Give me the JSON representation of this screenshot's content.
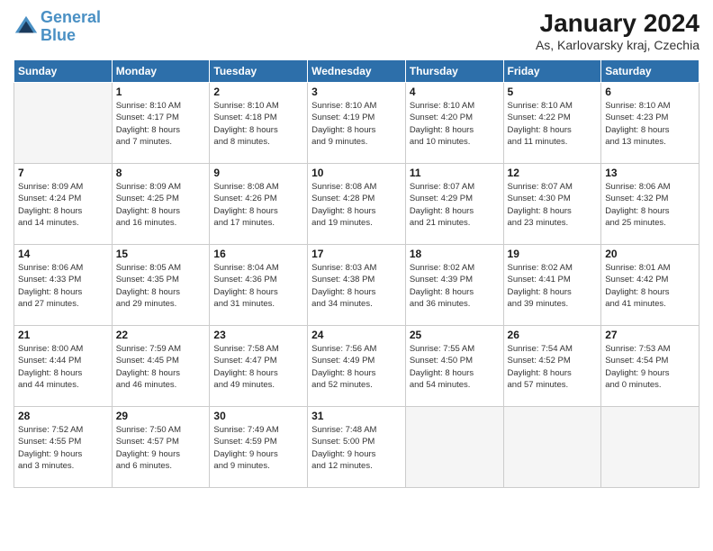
{
  "header": {
    "logo_line1": "General",
    "logo_line2": "Blue",
    "month_year": "January 2024",
    "location": "As, Karlovarsky kraj, Czechia"
  },
  "weekdays": [
    "Sunday",
    "Monday",
    "Tuesday",
    "Wednesday",
    "Thursday",
    "Friday",
    "Saturday"
  ],
  "weeks": [
    [
      {
        "num": "",
        "info": ""
      },
      {
        "num": "1",
        "info": "Sunrise: 8:10 AM\nSunset: 4:17 PM\nDaylight: 8 hours\nand 7 minutes."
      },
      {
        "num": "2",
        "info": "Sunrise: 8:10 AM\nSunset: 4:18 PM\nDaylight: 8 hours\nand 8 minutes."
      },
      {
        "num": "3",
        "info": "Sunrise: 8:10 AM\nSunset: 4:19 PM\nDaylight: 8 hours\nand 9 minutes."
      },
      {
        "num": "4",
        "info": "Sunrise: 8:10 AM\nSunset: 4:20 PM\nDaylight: 8 hours\nand 10 minutes."
      },
      {
        "num": "5",
        "info": "Sunrise: 8:10 AM\nSunset: 4:22 PM\nDaylight: 8 hours\nand 11 minutes."
      },
      {
        "num": "6",
        "info": "Sunrise: 8:10 AM\nSunset: 4:23 PM\nDaylight: 8 hours\nand 13 minutes."
      }
    ],
    [
      {
        "num": "7",
        "info": "Sunrise: 8:09 AM\nSunset: 4:24 PM\nDaylight: 8 hours\nand 14 minutes."
      },
      {
        "num": "8",
        "info": "Sunrise: 8:09 AM\nSunset: 4:25 PM\nDaylight: 8 hours\nand 16 minutes."
      },
      {
        "num": "9",
        "info": "Sunrise: 8:08 AM\nSunset: 4:26 PM\nDaylight: 8 hours\nand 17 minutes."
      },
      {
        "num": "10",
        "info": "Sunrise: 8:08 AM\nSunset: 4:28 PM\nDaylight: 8 hours\nand 19 minutes."
      },
      {
        "num": "11",
        "info": "Sunrise: 8:07 AM\nSunset: 4:29 PM\nDaylight: 8 hours\nand 21 minutes."
      },
      {
        "num": "12",
        "info": "Sunrise: 8:07 AM\nSunset: 4:30 PM\nDaylight: 8 hours\nand 23 minutes."
      },
      {
        "num": "13",
        "info": "Sunrise: 8:06 AM\nSunset: 4:32 PM\nDaylight: 8 hours\nand 25 minutes."
      }
    ],
    [
      {
        "num": "14",
        "info": "Sunrise: 8:06 AM\nSunset: 4:33 PM\nDaylight: 8 hours\nand 27 minutes."
      },
      {
        "num": "15",
        "info": "Sunrise: 8:05 AM\nSunset: 4:35 PM\nDaylight: 8 hours\nand 29 minutes."
      },
      {
        "num": "16",
        "info": "Sunrise: 8:04 AM\nSunset: 4:36 PM\nDaylight: 8 hours\nand 31 minutes."
      },
      {
        "num": "17",
        "info": "Sunrise: 8:03 AM\nSunset: 4:38 PM\nDaylight: 8 hours\nand 34 minutes."
      },
      {
        "num": "18",
        "info": "Sunrise: 8:02 AM\nSunset: 4:39 PM\nDaylight: 8 hours\nand 36 minutes."
      },
      {
        "num": "19",
        "info": "Sunrise: 8:02 AM\nSunset: 4:41 PM\nDaylight: 8 hours\nand 39 minutes."
      },
      {
        "num": "20",
        "info": "Sunrise: 8:01 AM\nSunset: 4:42 PM\nDaylight: 8 hours\nand 41 minutes."
      }
    ],
    [
      {
        "num": "21",
        "info": "Sunrise: 8:00 AM\nSunset: 4:44 PM\nDaylight: 8 hours\nand 44 minutes."
      },
      {
        "num": "22",
        "info": "Sunrise: 7:59 AM\nSunset: 4:45 PM\nDaylight: 8 hours\nand 46 minutes."
      },
      {
        "num": "23",
        "info": "Sunrise: 7:58 AM\nSunset: 4:47 PM\nDaylight: 8 hours\nand 49 minutes."
      },
      {
        "num": "24",
        "info": "Sunrise: 7:56 AM\nSunset: 4:49 PM\nDaylight: 8 hours\nand 52 minutes."
      },
      {
        "num": "25",
        "info": "Sunrise: 7:55 AM\nSunset: 4:50 PM\nDaylight: 8 hours\nand 54 minutes."
      },
      {
        "num": "26",
        "info": "Sunrise: 7:54 AM\nSunset: 4:52 PM\nDaylight: 8 hours\nand 57 minutes."
      },
      {
        "num": "27",
        "info": "Sunrise: 7:53 AM\nSunset: 4:54 PM\nDaylight: 9 hours\nand 0 minutes."
      }
    ],
    [
      {
        "num": "28",
        "info": "Sunrise: 7:52 AM\nSunset: 4:55 PM\nDaylight: 9 hours\nand 3 minutes."
      },
      {
        "num": "29",
        "info": "Sunrise: 7:50 AM\nSunset: 4:57 PM\nDaylight: 9 hours\nand 6 minutes."
      },
      {
        "num": "30",
        "info": "Sunrise: 7:49 AM\nSunset: 4:59 PM\nDaylight: 9 hours\nand 9 minutes."
      },
      {
        "num": "31",
        "info": "Sunrise: 7:48 AM\nSunset: 5:00 PM\nDaylight: 9 hours\nand 12 minutes."
      },
      {
        "num": "",
        "info": ""
      },
      {
        "num": "",
        "info": ""
      },
      {
        "num": "",
        "info": ""
      }
    ]
  ]
}
